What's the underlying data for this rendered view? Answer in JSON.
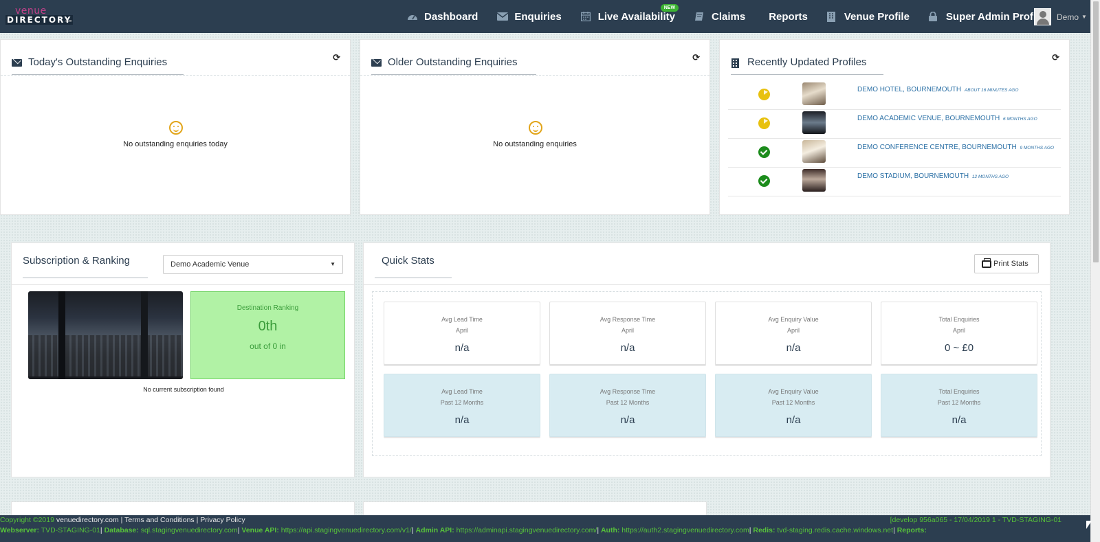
{
  "nav": {
    "logo_top": "venue",
    "logo_bottom": "DIRECTORY",
    "logo_suffix": ".com",
    "items": [
      {
        "label": "Dashboard",
        "icon": "dashboard-icon"
      },
      {
        "label": "Enquiries",
        "icon": "envelope-icon"
      },
      {
        "label": "Live Availability",
        "icon": "calendar-icon",
        "badge": "NEW"
      },
      {
        "label": "Claims",
        "icon": "book-icon"
      },
      {
        "label": "Reports"
      },
      {
        "label": "Venue Profile",
        "icon": "building-icon"
      },
      {
        "label": "Super Admin Profile",
        "icon": "lock-icon"
      }
    ],
    "user": "Demo"
  },
  "today_panel": {
    "title": "Today's Outstanding Enquiries",
    "empty_message": "No outstanding enquiries today"
  },
  "older_panel": {
    "title": "Older Outstanding Enquiries",
    "empty_message": "No outstanding enquiries"
  },
  "profiles_panel": {
    "title": "Recently Updated Profiles",
    "items": [
      {
        "name": "DEMO HOTEL, BOURNEMOUTH",
        "time": "ABOUT 16 MINUTES AGO",
        "status": "pending"
      },
      {
        "name": "DEMO ACADEMIC VENUE, BOURNEMOUTH",
        "time": "6 MONTHS AGO",
        "status": "pending"
      },
      {
        "name": "DEMO CONFERENCE CENTRE, BOURNEMOUTH",
        "time": "9 MONTHS AGO",
        "status": "approved"
      },
      {
        "name": "DEMO STADIUM, BOURNEMOUTH",
        "time": "12 MONTHS AGO",
        "status": "approved"
      }
    ]
  },
  "subscription": {
    "title": "Subscription & Ranking",
    "selected_venue": "Demo Academic Venue",
    "ranking_label": "Destination Ranking",
    "ranking_value": "0th",
    "ranking_sub": "out of 0 in",
    "no_subscription": "No current subscription found"
  },
  "quick_stats": {
    "title": "Quick Stats",
    "print_label": "Print Stats",
    "monthly": [
      {
        "label": "Avg Lead Time",
        "period": "April",
        "value": "n/a"
      },
      {
        "label": "Avg Response Time",
        "period": "April",
        "value": "n/a"
      },
      {
        "label": "Avg Enquiry Value",
        "period": "April",
        "value": "n/a"
      },
      {
        "label": "Total Enquiries",
        "period": "April",
        "value": "0 ~ £0"
      }
    ],
    "yearly": [
      {
        "label": "Avg Lead Time",
        "period": "Past 12 Months",
        "value": "n/a"
      },
      {
        "label": "Avg Response Time",
        "period": "Past 12 Months",
        "value": "n/a"
      },
      {
        "label": "Avg Enquiry Value",
        "period": "Past 12 Months",
        "value": "n/a"
      },
      {
        "label": "Total Enquiries",
        "period": "Past 12 Months",
        "value": "n/a"
      }
    ]
  },
  "footer": {
    "copyright": "Copyright ©2019",
    "site": "venuedirectory.com",
    "terms": "Terms and Conditions",
    "privacy": "Privacy Policy",
    "build": "[develop 956a065 - 17/04/2019 1 - TVD-STAGING-01",
    "webserver_label": "Webserver:",
    "webserver": "TVD-STAGING-01",
    "database_label": "Database:",
    "database": "sql.stagingvenuedirectory.com",
    "venue_api_label": "Venue API:",
    "venue_api": "https://api.stagingvenuedirectory.com/v1/",
    "admin_api_label": "Admin API:",
    "admin_api": "https://adminapi.stagingvenuedirectory.com/",
    "auth_label": "Auth:",
    "auth": "https://auth2.stagingvenuedirectory.com",
    "redis_label": "Redis:",
    "redis": "tvd-staging.redis.cache.windows.net",
    "reports_label": "Reports:"
  },
  "colors": {
    "navbar": "#2c3e50",
    "accent_green": "#57c23a",
    "ranking_bg": "#b1f2a5",
    "stat_alt_bg": "#d8ecf2",
    "link": "#2a6fa5"
  }
}
